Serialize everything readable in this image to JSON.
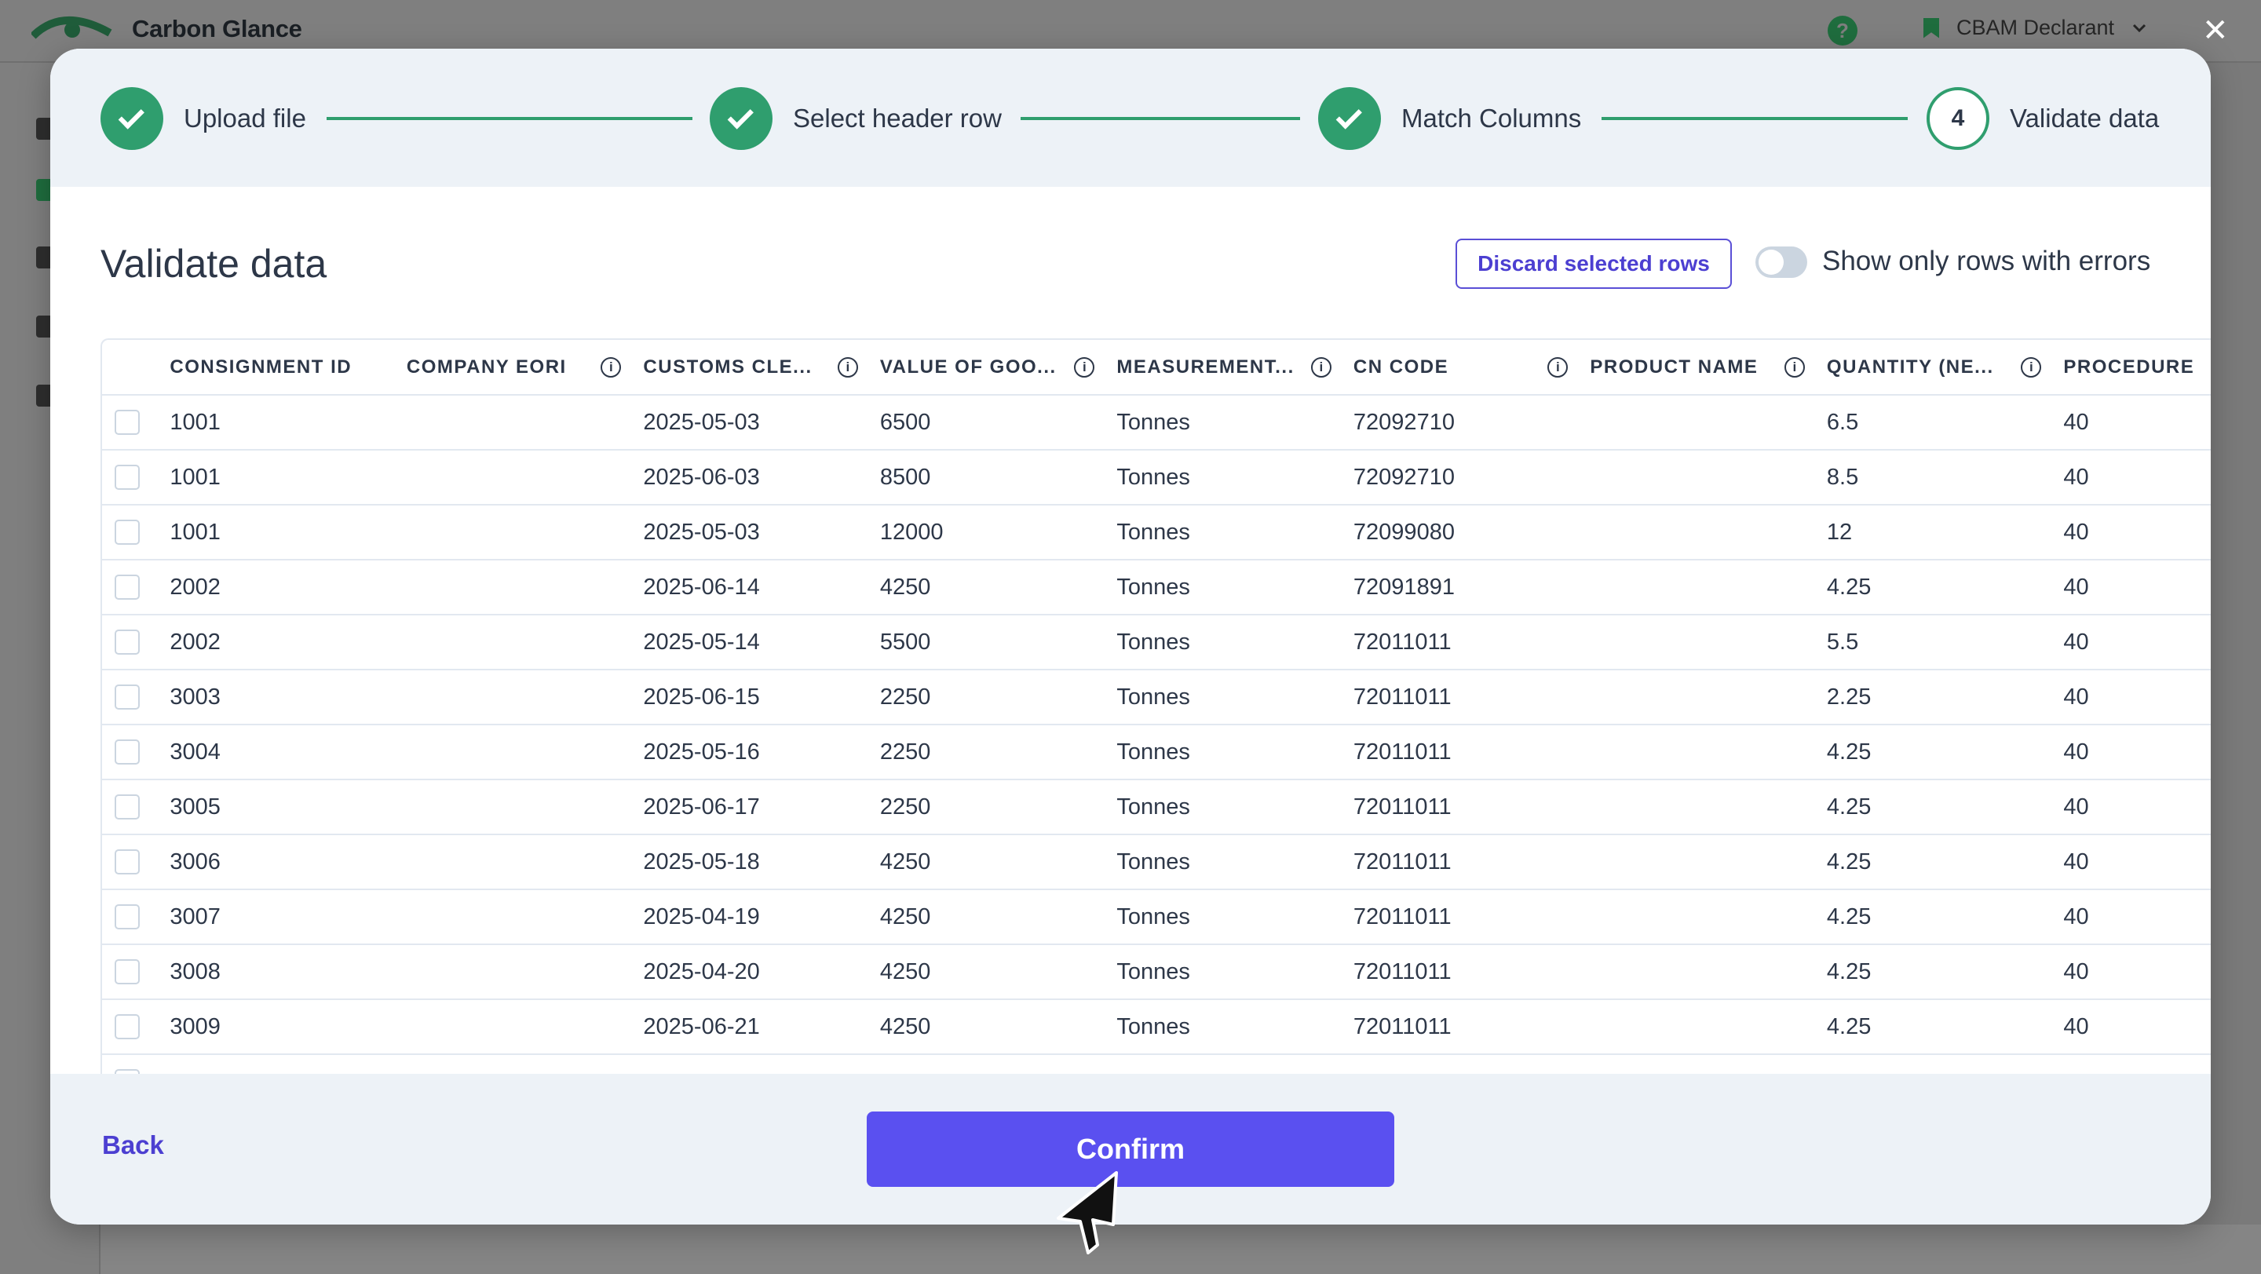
{
  "app": {
    "name": "Carbon Glance",
    "user_menu": "CBAM Declarant",
    "help_icon": "?"
  },
  "stepper": {
    "steps": [
      {
        "label": "Upload file",
        "status": "done"
      },
      {
        "label": "Select header row",
        "status": "done"
      },
      {
        "label": "Match Columns",
        "status": "done"
      },
      {
        "label": "Validate data",
        "status": "current",
        "number": "4"
      }
    ]
  },
  "main": {
    "title": "Validate data",
    "discard_label": "Discard selected rows",
    "toggle_label": "Show only rows with errors",
    "toggle_on": false
  },
  "table": {
    "columns": [
      {
        "label": "CONSIGNMENT ID",
        "info": false
      },
      {
        "label": "COMPANY EORI",
        "info": true
      },
      {
        "label": "CUSTOMS CLE...",
        "info": true
      },
      {
        "label": "VALUE OF GOO...",
        "info": true
      },
      {
        "label": "MEASUREMENT...",
        "info": true
      },
      {
        "label": "CN CODE",
        "info": true
      },
      {
        "label": "PRODUCT NAME",
        "info": true
      },
      {
        "label": "QUANTITY (NE...",
        "info": true
      },
      {
        "label": "PROCEDURE",
        "info": false
      }
    ],
    "rows": [
      [
        "1001",
        "",
        "2025-05-03",
        "6500",
        "Tonnes",
        "72092710",
        "",
        "6.5",
        "40"
      ],
      [
        "1001",
        "",
        "2025-06-03",
        "8500",
        "Tonnes",
        "72092710",
        "",
        "8.5",
        "40"
      ],
      [
        "1001",
        "",
        "2025-05-03",
        "12000",
        "Tonnes",
        "72099080",
        "",
        "12",
        "40"
      ],
      [
        "2002",
        "",
        "2025-06-14",
        "4250",
        "Tonnes",
        "72091891",
        "",
        "4.25",
        "40"
      ],
      [
        "2002",
        "",
        "2025-05-14",
        "5500",
        "Tonnes",
        "72011011",
        "",
        "5.5",
        "40"
      ],
      [
        "3003",
        "",
        "2025-06-15",
        "2250",
        "Tonnes",
        "72011011",
        "",
        "2.25",
        "40"
      ],
      [
        "3004",
        "",
        "2025-05-16",
        "2250",
        "Tonnes",
        "72011011",
        "",
        "4.25",
        "40"
      ],
      [
        "3005",
        "",
        "2025-06-17",
        "2250",
        "Tonnes",
        "72011011",
        "",
        "4.25",
        "40"
      ],
      [
        "3006",
        "",
        "2025-05-18",
        "4250",
        "Tonnes",
        "72011011",
        "",
        "4.25",
        "40"
      ],
      [
        "3007",
        "",
        "2025-04-19",
        "4250",
        "Tonnes",
        "72011011",
        "",
        "4.25",
        "40"
      ],
      [
        "3008",
        "",
        "2025-04-20",
        "4250",
        "Tonnes",
        "72011011",
        "",
        "4.25",
        "40"
      ],
      [
        "3009",
        "",
        "2025-06-21",
        "4250",
        "Tonnes",
        "72011011",
        "",
        "4.25",
        "40"
      ],
      [
        "",
        "",
        "",
        "",
        "",
        "",
        "",
        "",
        ""
      ]
    ]
  },
  "footer": {
    "back_label": "Back",
    "confirm_label": "Confirm"
  },
  "colors": {
    "accent": "#5a50f0",
    "success": "#2f9e6e",
    "brand_green": "#1f6d3e"
  },
  "icons": [
    "eye-logo-icon",
    "help-icon",
    "bookmark-icon",
    "chevron-down-icon",
    "close-icon",
    "check-icon",
    "info-icon",
    "cursor-icon"
  ]
}
